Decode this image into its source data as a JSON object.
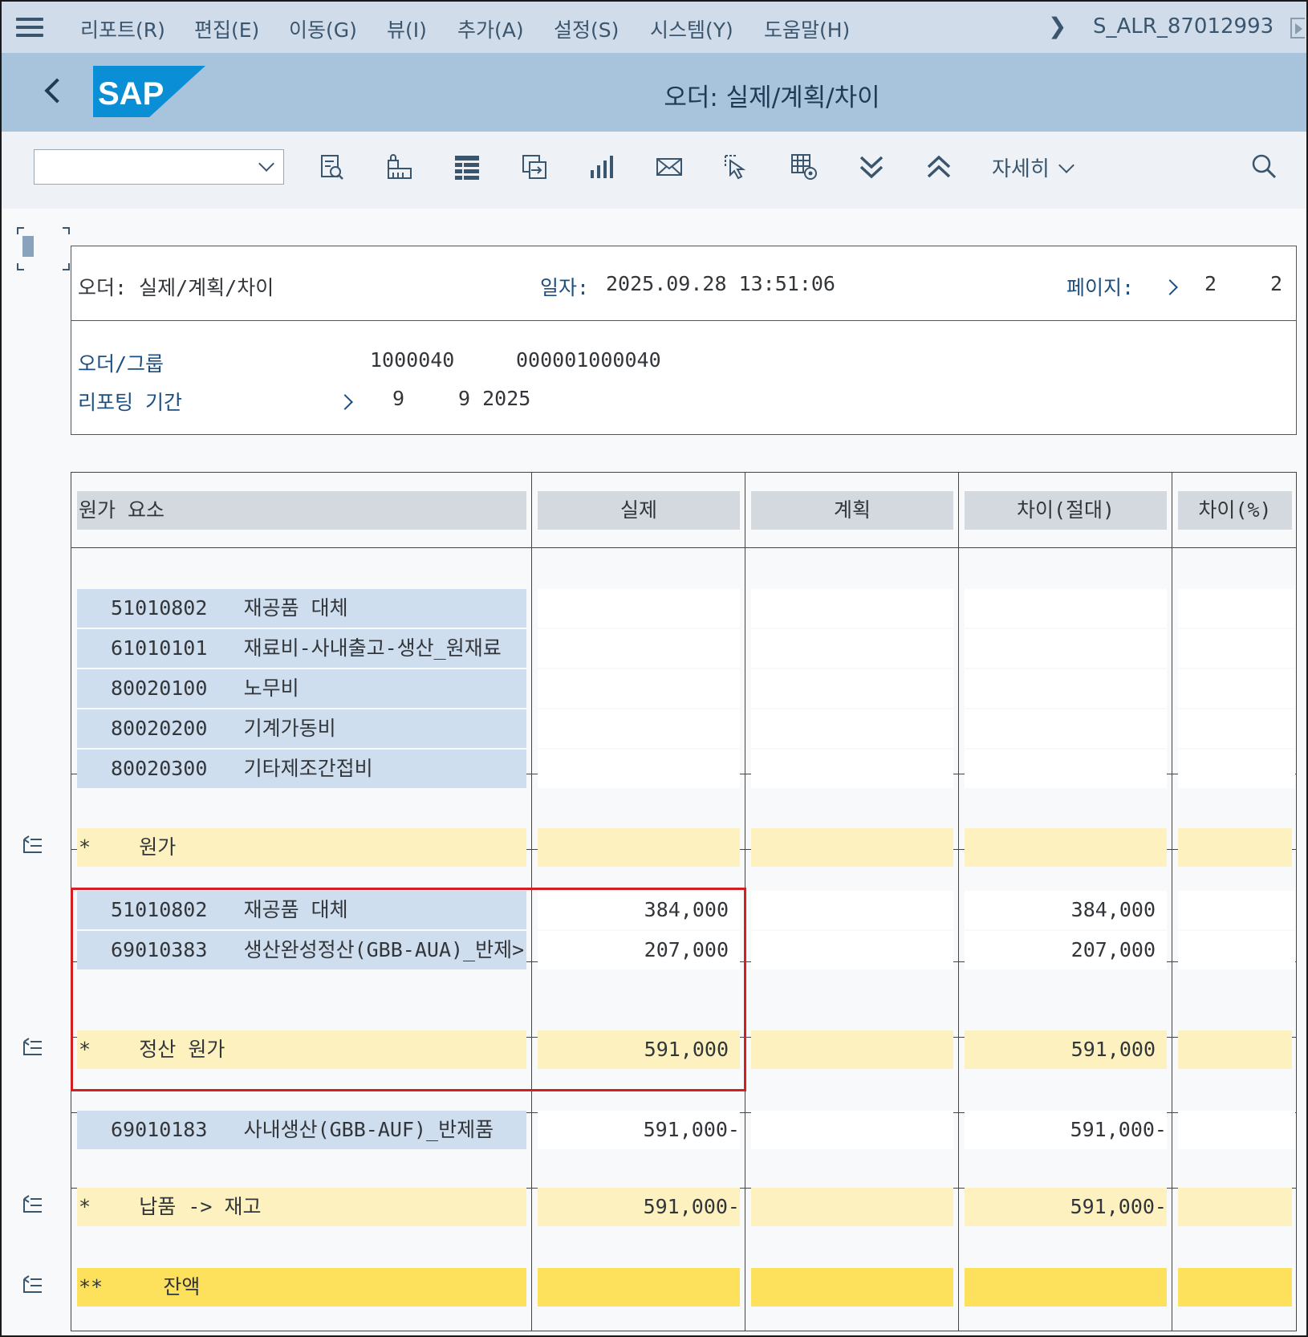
{
  "menu": {
    "items": [
      "리포트(R)",
      "편집(E)",
      "이동(G)",
      "뷰(I)",
      "추가(A)",
      "설정(S)",
      "시스템(Y)",
      "도움말(H)"
    ],
    "transaction_code": "S_ALR_87012993"
  },
  "titlebar": {
    "logo_text": "SAP",
    "title": "오더: 실제/계획/차이"
  },
  "toolbar": {
    "layout_value": "",
    "icons": [
      "report-selection-icon",
      "lock-print-icon",
      "layout-grid-icon",
      "export-icon",
      "chart-icon",
      "mail-icon",
      "select-icon",
      "settings-grid-icon",
      "expand-all-icon",
      "collapse-all-icon",
      "search-icon"
    ],
    "more_label": "자세히"
  },
  "report_header": {
    "title": "오더: 실제/계획/차이",
    "date_label": "일자:",
    "date_value": "2025.09.28 13:51:06",
    "page_label": "페이지:",
    "page_current": "2",
    "page_total": "2"
  },
  "selection": {
    "order_label": "오더/그룹",
    "order_value1": "1000040",
    "order_value2": "000001000040",
    "period_label": "리포팅 기간",
    "period_from": "9",
    "period_to": "9 2025"
  },
  "table": {
    "columns": [
      "원가 요소",
      "실제",
      "계획",
      "차이(절대)",
      "차이(%)"
    ],
    "group1": [
      {
        "code": "51010802",
        "name": "재공품 대체"
      },
      {
        "code": "61010101",
        "name": "재료비-사내출고-생산_원재료"
      },
      {
        "code": "80020100",
        "name": "노무비"
      },
      {
        "code": "80020200",
        "name": "기계가동비"
      },
      {
        "code": "80020300",
        "name": "기타제조간접비"
      }
    ],
    "sum1": {
      "marker": "*",
      "label": "원가",
      "actual": "",
      "plan": "",
      "variance": "",
      "pct": ""
    },
    "group2": [
      {
        "code": "51010802",
        "name": "재공품 대체",
        "actual": "384,000",
        "plan": "",
        "variance": "384,000",
        "pct": ""
      },
      {
        "code": "69010383",
        "name": "생산완성정산(GBB-AUA)_반제>",
        "actual": "207,000",
        "plan": "",
        "variance": "207,000",
        "pct": ""
      }
    ],
    "sum2": {
      "marker": "*",
      "label": "정산 원가",
      "actual": "591,000",
      "plan": "",
      "variance": "591,000",
      "pct": ""
    },
    "group3": [
      {
        "code": "69010183",
        "name": "사내생산(GBB-AUF)_반제품",
        "actual": "591,000-",
        "plan": "",
        "variance": "591,000-",
        "pct": ""
      }
    ],
    "sum3": {
      "marker": "*",
      "label": "납품 -> 재고",
      "actual": "591,000-",
      "plan": "",
      "variance": "591,000-",
      "pct": ""
    },
    "total": {
      "marker": "**",
      "label": "잔액",
      "actual": "",
      "plan": "",
      "variance": "",
      "pct": ""
    }
  },
  "colors": {
    "highlight_box": "#d21f22",
    "subtotal": "#fdf2bf",
    "total": "#fde05c",
    "key_cell": "#cfdeee"
  }
}
